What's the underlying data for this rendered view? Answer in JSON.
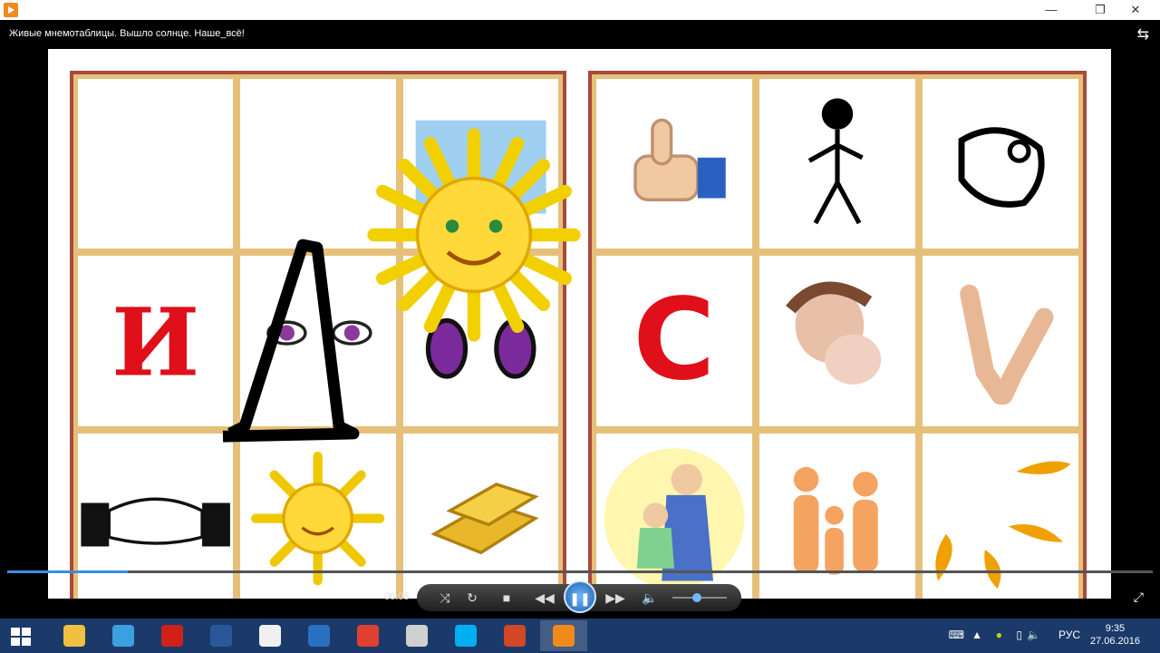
{
  "window": {
    "minimize": "—",
    "restore": "❐",
    "close": "✕"
  },
  "player": {
    "title": "Живые мнемотаблицы. Вышло солнце. Наше_всё!",
    "time": "00:05",
    "progress": 0.105,
    "volume": 0.45,
    "controls": {
      "repeat": "↻",
      "stop": "■",
      "prev": "◀◀",
      "pause": "❚❚",
      "next": "▶▶",
      "volume": "🔈"
    }
  },
  "slide": {
    "letters": {
      "i": "И",
      "s": "С"
    }
  },
  "taskbar": {
    "lang": "РУС",
    "time": "9:35",
    "date": "27.06.2016",
    "apps": [
      {
        "name": "file-explorer",
        "color": "#f0c040"
      },
      {
        "name": "computer",
        "color": "#3aa0e0"
      },
      {
        "name": "opera",
        "color": "#d0201a"
      },
      {
        "name": "word",
        "color": "#2b579a"
      },
      {
        "name": "yandex",
        "color": "#f0f0f0"
      },
      {
        "name": "sound",
        "color": "#2a70c0"
      },
      {
        "name": "chrome",
        "color": "#e04030"
      },
      {
        "name": "paint",
        "color": "#d0d0d0"
      },
      {
        "name": "skype",
        "color": "#00aff0"
      },
      {
        "name": "powerpoint",
        "color": "#d24726"
      },
      {
        "name": "media-player",
        "color": "#f08a1c"
      }
    ]
  }
}
